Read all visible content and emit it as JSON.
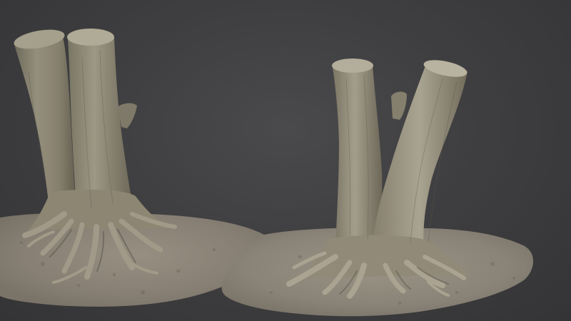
{
  "scene": {
    "background_color": "#3f3f41",
    "objects": [
      {
        "name": "tree-stump-left",
        "description_color": "#8a8572"
      },
      {
        "name": "tree-stump-right",
        "description_color": "#938d7c"
      }
    ],
    "ground_color": "#8b8479",
    "root_color": "#a7a090"
  }
}
